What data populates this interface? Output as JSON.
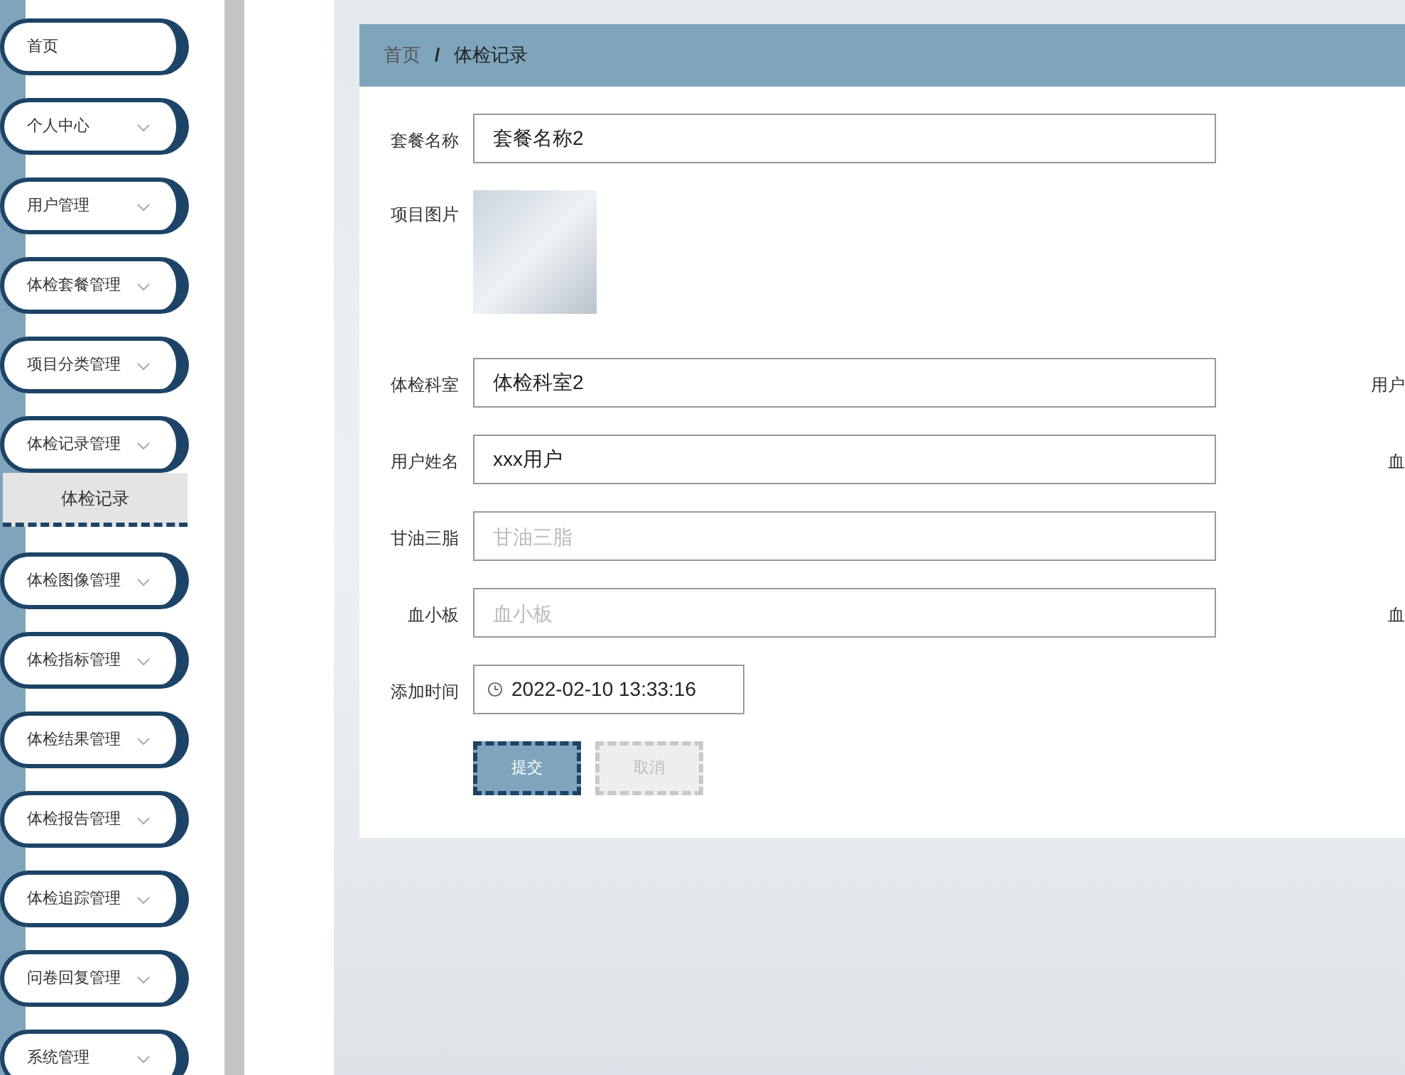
{
  "sidebar": {
    "items": [
      {
        "label": "首页",
        "kind": "link"
      },
      {
        "label": "个人中心",
        "kind": "submenu"
      },
      {
        "label": "用户管理",
        "kind": "submenu"
      },
      {
        "label": "体检套餐管理",
        "kind": "submenu"
      },
      {
        "label": "项目分类管理",
        "kind": "submenu"
      },
      {
        "label": "体检记录管理",
        "kind": "submenu",
        "children": [
          {
            "label": "体检记录",
            "selected": true
          }
        ]
      },
      {
        "label": "体检图像管理",
        "kind": "submenu"
      },
      {
        "label": "体检指标管理",
        "kind": "submenu"
      },
      {
        "label": "体检结果管理",
        "kind": "submenu"
      },
      {
        "label": "体检报告管理",
        "kind": "submenu"
      },
      {
        "label": "体检追踪管理",
        "kind": "submenu"
      },
      {
        "label": "问卷回复管理",
        "kind": "submenu"
      },
      {
        "label": "系统管理",
        "kind": "submenu"
      }
    ]
  },
  "breadcrumb": {
    "separator": "/",
    "items": [
      "首页",
      "体检记录"
    ]
  },
  "form": {
    "fields": [
      {
        "label": "套餐名称",
        "kind": "text",
        "value": "套餐名称2"
      },
      {
        "label": "项目图片",
        "kind": "image"
      },
      {
        "label": "体检科室",
        "kind": "text",
        "value": "体检科室2",
        "right_label": "用户"
      },
      {
        "label": "用户姓名",
        "kind": "text",
        "value": "xxx用户",
        "right_label": "血"
      },
      {
        "label": "甘油三脂",
        "kind": "text",
        "placeholder": "甘油三脂"
      },
      {
        "label": "血小板",
        "kind": "text",
        "placeholder": "血小板",
        "right_label": "血"
      },
      {
        "label": "添加时间",
        "kind": "datetime",
        "value": "2022-02-10 13:33:16"
      }
    ],
    "buttons": [
      {
        "label": "提交",
        "kind": "primary"
      },
      {
        "label": "取消",
        "kind": "cancel"
      }
    ]
  }
}
